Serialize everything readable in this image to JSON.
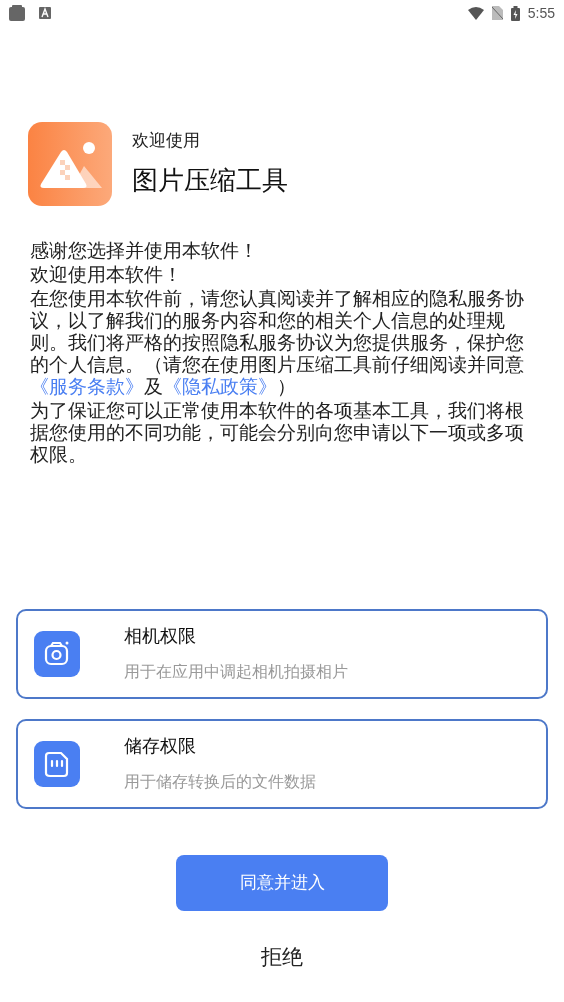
{
  "status_bar": {
    "time": "5:55"
  },
  "header": {
    "greeting": "欢迎使用",
    "app_name": "图片压缩工具"
  },
  "paragraphs": [
    [
      {
        "kind": "text",
        "text": "感谢您选择并使用本软件！"
      }
    ],
    [
      {
        "kind": "text",
        "text": "欢迎使用本软件！"
      }
    ],
    [
      {
        "kind": "text",
        "text": "在您使用本软件前，请您认真阅读并了解相应的隐私服务协议，以了解我们的服务内容和您的相关个人信息的处理规则。我们将严格的按照隐私服务协议为您提供服务，保护您的个人信息。（请您在使用图片压缩工具前仔细阅读并同意"
      },
      {
        "kind": "link",
        "text": "《服务条款》"
      },
      {
        "kind": "text",
        "text": "及"
      },
      {
        "kind": "link",
        "text": "《隐私政策》"
      },
      {
        "kind": "text",
        "text": "）"
      }
    ],
    [
      {
        "kind": "text",
        "text": "为了保证您可以正常使用本软件的各项基本工具，我们将根据您使用的不同功能，可能会分别向您申请以下一项或多项权限。"
      }
    ]
  ],
  "permissions": [
    {
      "kind": "camera",
      "title": "相机权限",
      "description": "用于在应用中调起相机拍摄相片"
    },
    {
      "kind": "storage",
      "title": "储存权限",
      "description": "用于储存转换后的文件数据"
    }
  ],
  "agree_button": "同意并进入",
  "decline_button": "拒绝"
}
